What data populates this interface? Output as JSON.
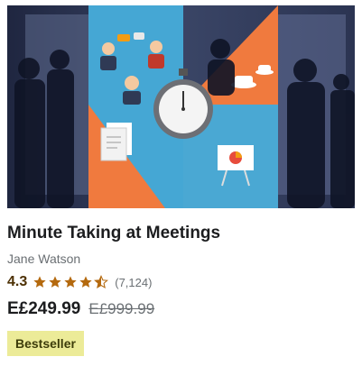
{
  "course": {
    "title": "Minute Taking at Meetings",
    "author": "Jane Watson",
    "rating": "4.3",
    "rating_fraction": 0.86,
    "rating_count": "(7,124)",
    "price": "E£249.99",
    "original_price": "E£999.99",
    "badge": "Bestseller"
  },
  "icons": {
    "star": "star-icon",
    "half_star": "star-half-icon"
  },
  "colors": {
    "star": "#b4690e",
    "badge_bg": "#eceb98",
    "accent_orange": "#f47c3c",
    "accent_blue": "#3fa9d8"
  }
}
